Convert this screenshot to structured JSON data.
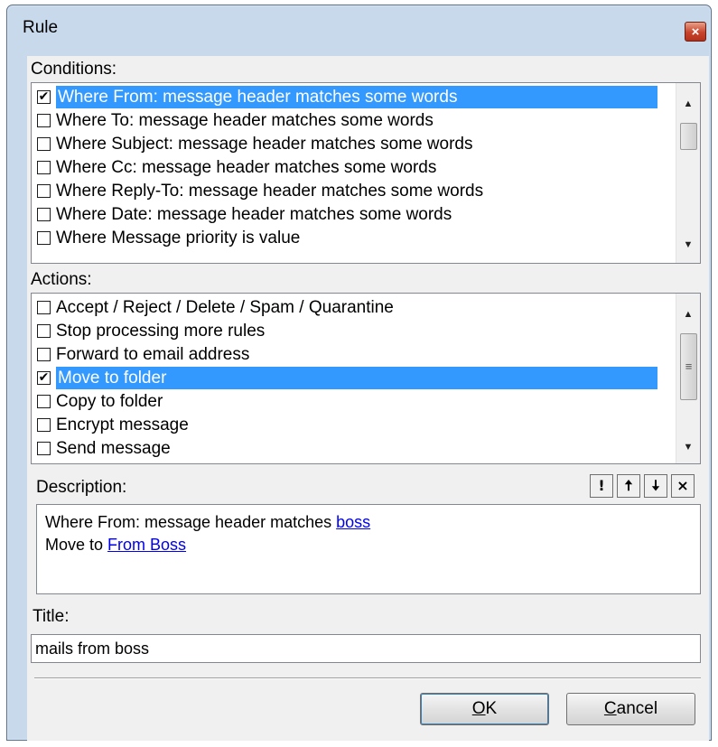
{
  "window": {
    "title": "Rule",
    "close_glyph": "×"
  },
  "conditions": {
    "label": "Conditions:",
    "items": [
      {
        "label": "Where From: message header matches some words",
        "checked": true,
        "selected": true
      },
      {
        "label": "Where To: message header matches some words",
        "checked": false,
        "selected": false
      },
      {
        "label": "Where Subject: message header matches some words",
        "checked": false,
        "selected": false
      },
      {
        "label": "Where Cc: message header matches some words",
        "checked": false,
        "selected": false
      },
      {
        "label": "Where Reply-To: message header matches some words",
        "checked": false,
        "selected": false
      },
      {
        "label": "Where Date: message header matches some words",
        "checked": false,
        "selected": false
      },
      {
        "label": "Where Message priority is value",
        "checked": false,
        "selected": false
      }
    ]
  },
  "actions": {
    "label": "Actions:",
    "items": [
      {
        "label": "Accept / Reject / Delete / Spam / Quarantine",
        "checked": false,
        "selected": false
      },
      {
        "label": "Stop processing more rules",
        "checked": false,
        "selected": false
      },
      {
        "label": "Forward to email address",
        "checked": false,
        "selected": false
      },
      {
        "label": "Move to folder",
        "checked": true,
        "selected": true
      },
      {
        "label": "Copy to folder",
        "checked": false,
        "selected": false
      },
      {
        "label": "Encrypt message",
        "checked": false,
        "selected": false
      },
      {
        "label": "Send message",
        "checked": false,
        "selected": false
      }
    ]
  },
  "description": {
    "label": "Description:",
    "line1_prefix": "Where From: message header matches ",
    "line1_link": "boss",
    "line2_prefix": "Move to ",
    "line2_link": "From Boss",
    "tools": {
      "importance_glyph": "!",
      "up_glyph": "🠅",
      "down_glyph": "🠇",
      "delete_glyph": "×"
    }
  },
  "title_field": {
    "label": "Title:",
    "value": "mails from boss"
  },
  "buttons": {
    "ok_mnemonic": "O",
    "ok_rest": "K",
    "cancel_mnemonic": "C",
    "cancel_rest": "ancel"
  },
  "icons": {
    "close": "close-icon",
    "scroll_up": "scroll-up-icon",
    "scroll_down": "scroll-down-icon",
    "check": "checkmark-icon"
  },
  "colors": {
    "selection": "#3399ff",
    "window_frame": "#c9d9ec",
    "close_button": "#c8432b",
    "link": "#0000ee"
  }
}
